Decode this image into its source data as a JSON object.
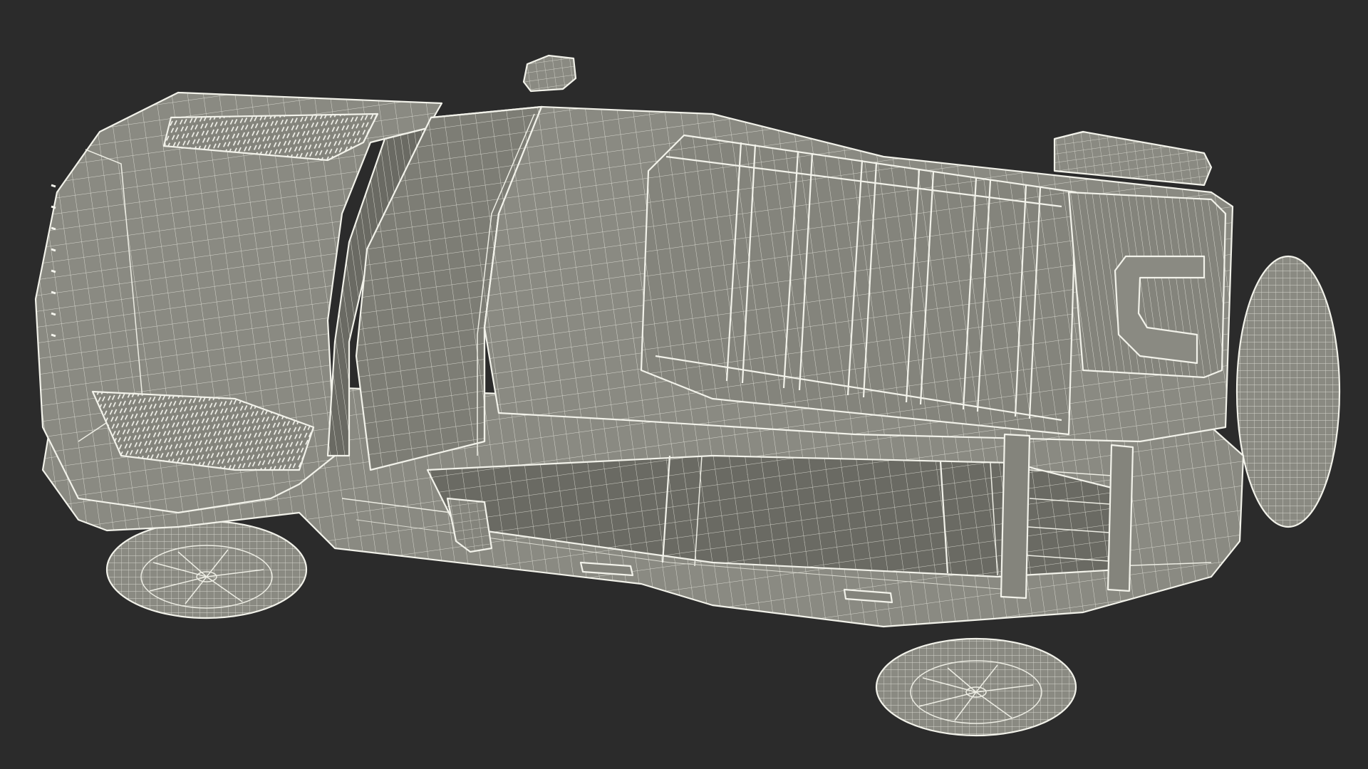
{
  "scene": {
    "background_color": "#2b2b2b",
    "wire_color": "#f2f2ea",
    "surface_color": "#8a8a82",
    "subject": "vehicle-wireframe"
  }
}
